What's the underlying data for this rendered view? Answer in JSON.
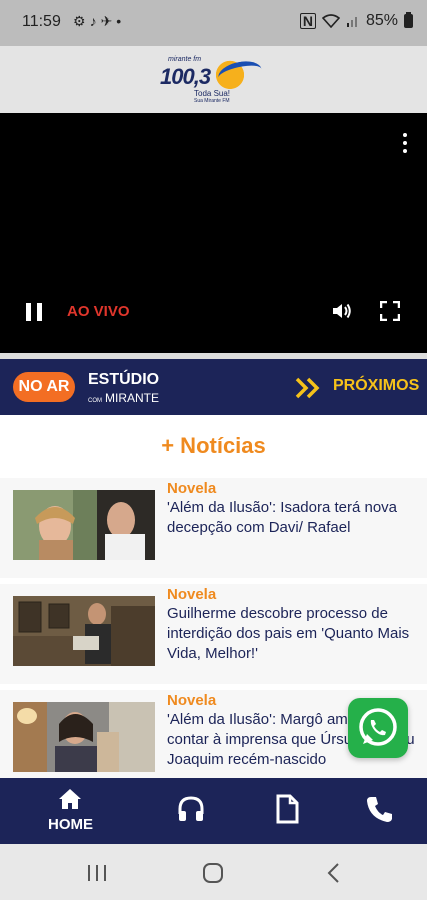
{
  "status_bar": {
    "time": "11:59",
    "battery": "85%"
  },
  "logo": {
    "top_text": "mirante fm",
    "number": "100,3",
    "tagline": "Toda Sua!",
    "sub_tagline": "Sua Mirante FM"
  },
  "player": {
    "live_label": "AO VIVO"
  },
  "on_air": {
    "badge": "NO AR",
    "program_title": "ESTÚDIO",
    "program_prefix": "COM",
    "program_host": "MIRANTE",
    "next_label": "PRÓXIMOS"
  },
  "news": {
    "section_title": "+ Notícias",
    "items": [
      {
        "category": "Novela",
        "headline": "'Além da Ilusão': Isadora terá nova decepção com Davi/ Rafael"
      },
      {
        "category": "Novela",
        "headline": "Guilherme descobre processo de interdição dos pais em 'Quanto Mais Vida, Melhor!'"
      },
      {
        "category": "Novela",
        "headline": "'Além da Ilusão': Margô ameaçará contar à imprensa que Úrsula roubou Joaquim recém-nascido"
      }
    ]
  },
  "bottom_nav": {
    "home_label": "HOME"
  },
  "colors": {
    "navy": "#1c2458",
    "orange": "#ef8a1f",
    "live_red": "#e0362c",
    "whatsapp_green": "#25b04a",
    "proximos_yellow": "#f6c21a"
  }
}
